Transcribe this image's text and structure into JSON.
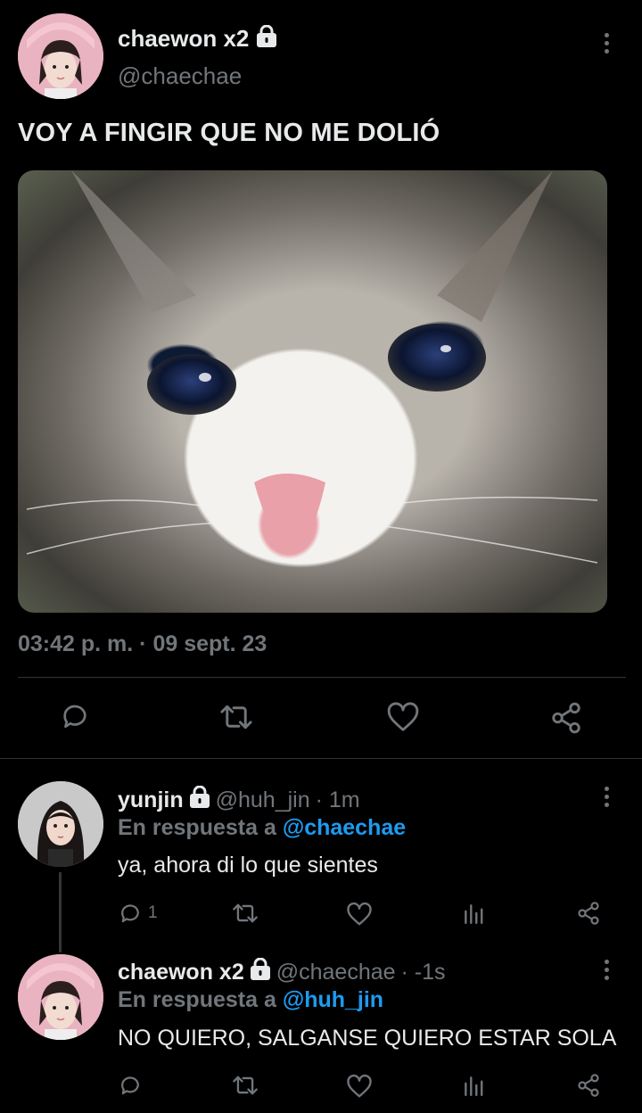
{
  "main_tweet": {
    "author_name": "chaewon x2",
    "handle": "@chaechae",
    "text": "VOY A FINGIR QUE NO ME DOLIÓ",
    "timestamp": "03:42 p. m. · 09 sept. 23"
  },
  "replies": [
    {
      "author_name": "yunjin",
      "handle": "@huh_jin",
      "time": "· 1m",
      "reply_prefix": "En respuesta a",
      "reply_to": "@chaechae",
      "text": "ya, ahora di lo que sientes",
      "reply_count": "1"
    },
    {
      "author_name": "chaewon x2",
      "handle": "@chaechae",
      "time": "· -1s",
      "reply_prefix": "En respuesta a",
      "reply_to": "@huh_jin",
      "text": "NO QUIERO, SALGANSE QUIERO ESTAR SOLA"
    }
  ],
  "colors": {
    "background": "#000000",
    "text": "#e7e9ea",
    "secondary": "#71767b",
    "link": "#1d9bf0",
    "divider": "#2f3336"
  },
  "icons": [
    "lock-icon",
    "more-icon",
    "reply-icon",
    "retweet-icon",
    "like-icon",
    "share-icon",
    "analytics-icon"
  ]
}
